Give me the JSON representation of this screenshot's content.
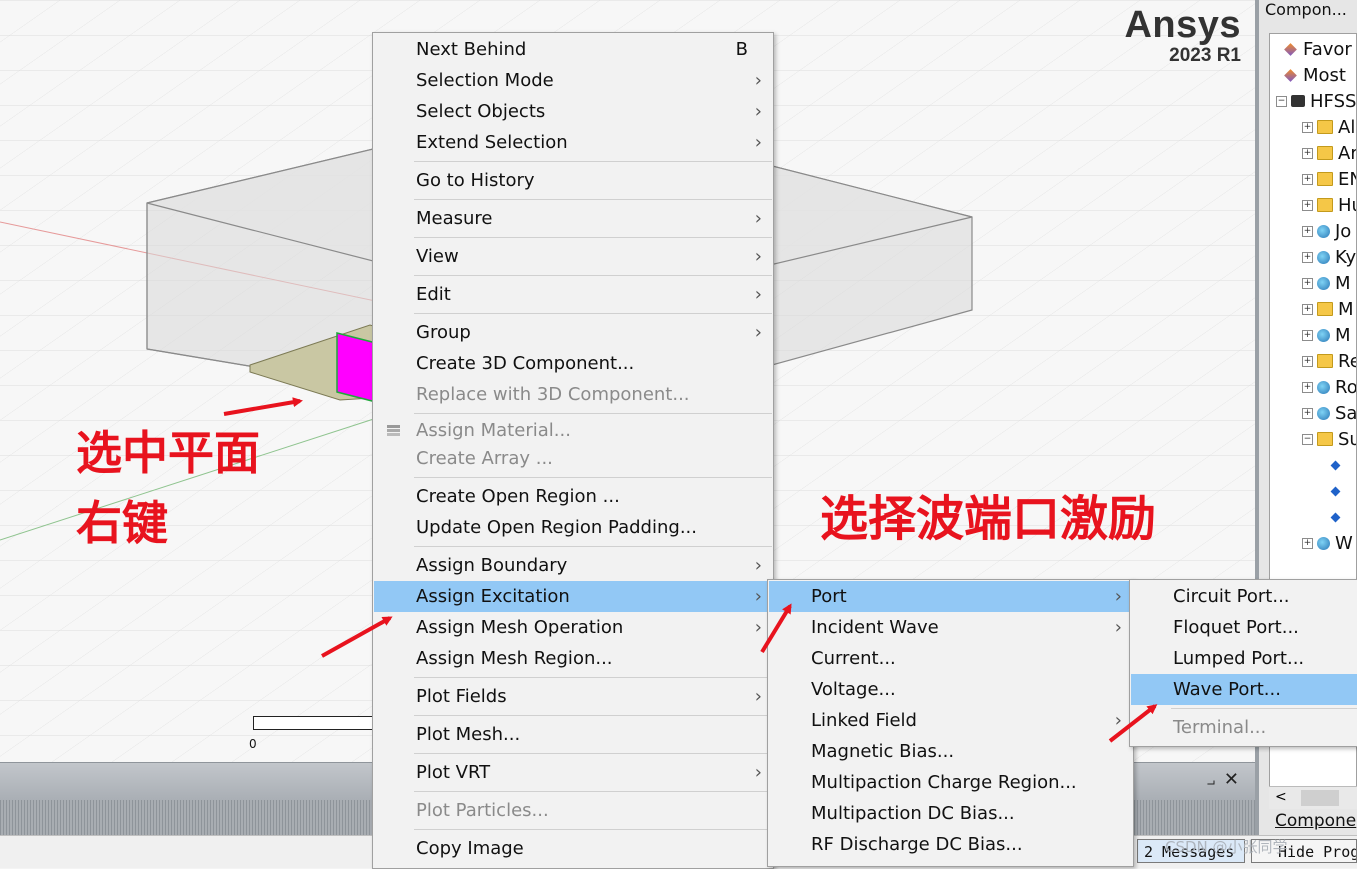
{
  "logo": {
    "brand": "Ansys",
    "version": "2023 R1"
  },
  "viewport": {
    "ruler_zero": "0"
  },
  "context_menu": {
    "items": [
      {
        "label": "Next Behind",
        "shortcut": "B",
        "submenu": false,
        "disabled": false
      },
      {
        "label": "Selection Mode",
        "submenu": true,
        "disabled": false
      },
      {
        "label": "Select Objects",
        "submenu": true,
        "disabled": false
      },
      {
        "label": "Extend Selection",
        "submenu": true,
        "disabled": false
      },
      {
        "label": "Go to History",
        "submenu": false,
        "disabled": false
      },
      {
        "label": "Measure",
        "submenu": true,
        "disabled": false
      },
      {
        "label": "View",
        "submenu": true,
        "disabled": false
      },
      {
        "label": "Edit",
        "submenu": true,
        "disabled": false
      },
      {
        "label": "Group",
        "submenu": true,
        "disabled": false
      },
      {
        "label": "Create 3D Component...",
        "submenu": false,
        "disabled": false
      },
      {
        "label": "Replace with 3D Component...",
        "submenu": false,
        "disabled": true
      },
      {
        "label": "Assign Material...",
        "submenu": false,
        "disabled": true,
        "icon": "material-icon"
      },
      {
        "label": "Create Array ...",
        "submenu": false,
        "disabled": true
      },
      {
        "label": "Create Open Region ...",
        "submenu": false,
        "disabled": false
      },
      {
        "label": "Update Open Region Padding...",
        "submenu": false,
        "disabled": false
      },
      {
        "label": "Assign Boundary",
        "submenu": true,
        "disabled": false
      },
      {
        "label": "Assign Excitation",
        "submenu": true,
        "disabled": false,
        "highlighted": true
      },
      {
        "label": "Assign Mesh Operation",
        "submenu": true,
        "disabled": false
      },
      {
        "label": "Assign Mesh Region...",
        "submenu": false,
        "disabled": false
      },
      {
        "label": "Plot Fields",
        "submenu": true,
        "disabled": false
      },
      {
        "label": "Plot Mesh...",
        "submenu": false,
        "disabled": false
      },
      {
        "label": "Plot VRT",
        "submenu": true,
        "disabled": false
      },
      {
        "label": "Plot Particles...",
        "submenu": false,
        "disabled": true
      },
      {
        "label": "Copy Image",
        "submenu": false,
        "disabled": false
      }
    ]
  },
  "excitation_menu": {
    "items": [
      {
        "label": "Port",
        "submenu": true,
        "highlighted": true
      },
      {
        "label": "Incident Wave",
        "submenu": true
      },
      {
        "label": "Current...",
        "submenu": false
      },
      {
        "label": "Voltage...",
        "submenu": false
      },
      {
        "label": "Linked Field",
        "submenu": true
      },
      {
        "label": "Magnetic Bias...",
        "submenu": false
      },
      {
        "label": "Multipaction Charge Region...",
        "submenu": false
      },
      {
        "label": "Multipaction DC Bias...",
        "submenu": false
      },
      {
        "label": "RF Discharge DC Bias...",
        "submenu": false
      }
    ]
  },
  "port_menu": {
    "items": [
      {
        "label": "Circuit Port...",
        "disabled": false
      },
      {
        "label": "Floquet Port...",
        "disabled": false
      },
      {
        "label": "Lumped Port...",
        "disabled": false
      },
      {
        "label": "Wave Port...",
        "disabled": false,
        "highlighted": true
      },
      {
        "label": "Terminal...",
        "disabled": true
      }
    ]
  },
  "annotations": {
    "select_plane": "选中平面",
    "right_click": "右键",
    "choose_wave_port": "选择波端口激励"
  },
  "tree_panel": {
    "header": "Compon...",
    "items": [
      {
        "label": "Favor",
        "icon": "favorites-icon"
      },
      {
        "label": "Most",
        "icon": "favorites-icon"
      },
      {
        "label": "HFSS",
        "icon": "hfss-icon"
      },
      {
        "label": "Al",
        "icon": "folder-icon"
      },
      {
        "label": "Ar",
        "icon": "folder-icon"
      },
      {
        "label": "EN",
        "icon": "folder-icon"
      },
      {
        "label": "Hu",
        "icon": "folder-icon"
      },
      {
        "label": "Jo",
        "icon": "component-icon"
      },
      {
        "label": "Ky",
        "icon": "component-icon"
      },
      {
        "label": "M",
        "icon": "component-icon"
      },
      {
        "label": "M",
        "icon": "folder-icon"
      },
      {
        "label": "M",
        "icon": "component-icon"
      },
      {
        "label": "Re",
        "icon": "folder-icon"
      },
      {
        "label": "Ro",
        "icon": "component-icon"
      },
      {
        "label": "Sa",
        "icon": "component-icon"
      },
      {
        "label": "Su",
        "icon": "folder-icon"
      },
      {
        "label": "",
        "icon": "leaf-icon"
      },
      {
        "label": "",
        "icon": "leaf-icon"
      },
      {
        "label": "",
        "icon": "leaf-icon"
      },
      {
        "label": "W",
        "icon": "component-icon"
      }
    ],
    "footer": "Compone"
  },
  "status_bar": {
    "messages": "2 Messages",
    "progress": "Hide Prog",
    "watermark": "CSDN @小张同学"
  },
  "colors": {
    "highlight": "#92c8f5",
    "annotation": "#e8131e",
    "port_face": "#ff00ff"
  }
}
